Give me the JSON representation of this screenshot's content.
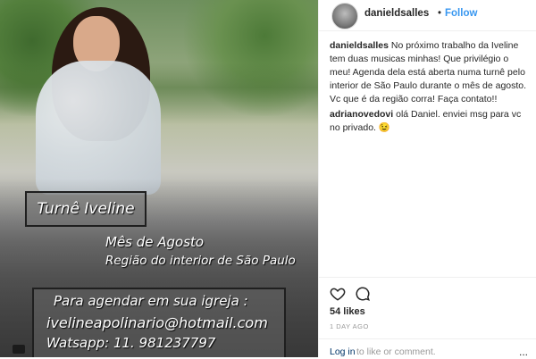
{
  "post": {
    "overlay": {
      "title": "Turnê Iveline",
      "line1": "Mês de Agosto",
      "line2": "Região do interior de São Paulo",
      "booking": [
        "Para agendar em sua igreja :",
        "ivelineapolinario@hotmail.com",
        "Watsapp: 11. 981237797"
      ]
    }
  },
  "header": {
    "username": "danieldsalles",
    "separator": "•",
    "follow_label": "Follow"
  },
  "comments": [
    {
      "user": "danieldsalles",
      "text": "No próximo trabalho da Iveline tem duas musicas minhas! Que privilégio o meu! Agenda dela está aberta numa turnê pelo interior de São Paulo durante o mês de agosto. Vc que é da região corra! Faça contato!!"
    },
    {
      "user": "adrianovedovi",
      "text": "olá Daniel. enviei msg para vc no privado. 😉"
    }
  ],
  "footer": {
    "likes": "54 likes",
    "time": "1 DAY AGO",
    "login_link": "Log in",
    "login_rest": "to like or comment.",
    "more": "..."
  },
  "colors": {
    "follow": "#3897f0",
    "link": "#003569"
  },
  "icons": [
    "heart-icon",
    "comment-bubble-icon",
    "camera-icon",
    "more-icon"
  ]
}
